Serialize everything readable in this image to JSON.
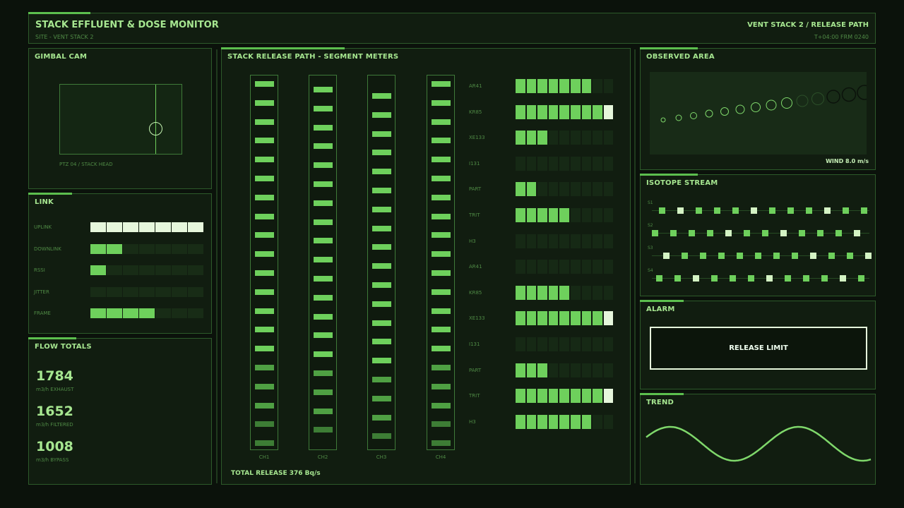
{
  "header": {
    "title": "STACK EFFLUENT & DOSE MONITOR",
    "site": "SITE - VENT STACK 2",
    "right_title": "VENT STACK 2 / RELEASE PATH",
    "time": "T+04:00  FRM 0240"
  },
  "gimbal": {
    "title": "GIMBAL CAM",
    "label": "PTZ 04 / STACK HEAD"
  },
  "link": {
    "title": "LINK",
    "rows": [
      {
        "label": "UPLINK",
        "on": 7,
        "style": "hi"
      },
      {
        "label": "DOWNLINK",
        "on": 2,
        "style": "on"
      },
      {
        "label": "RSSI",
        "on": 1,
        "style": "on"
      },
      {
        "label": "JITTER",
        "on": 0,
        "style": "on"
      },
      {
        "label": "FRAME",
        "on": 4,
        "style": "on"
      }
    ],
    "segments": 7
  },
  "flow": {
    "title": "FLOW TOTALS",
    "items": [
      {
        "value": "1784",
        "unit": "m3/h EXHAUST"
      },
      {
        "value": "1652",
        "unit": "m3/h FILTERED"
      },
      {
        "value": "1008",
        "unit": "m3/h BYPASS"
      }
    ]
  },
  "center": {
    "title": "STACK RELEASE PATH - SEGMENT METERS",
    "columns": [
      "CH1",
      "CH2",
      "CH3",
      "CH4"
    ],
    "total": "TOTAL RELEASE 376 Bq/s",
    "meter_segments": 9,
    "meters": [
      {
        "label": "AR41",
        "on": 7,
        "peak": false
      },
      {
        "label": "KR85",
        "on": 9,
        "peak": true
      },
      {
        "label": "XE133",
        "on": 3,
        "peak": false
      },
      {
        "label": "I131",
        "on": 0,
        "peak": false
      },
      {
        "label": "PART",
        "on": 2,
        "peak": false
      },
      {
        "label": "TRIT",
        "on": 5,
        "peak": false
      },
      {
        "label": "H3",
        "on": 0,
        "peak": false
      },
      {
        "label": "AR41",
        "on": 0,
        "peak": false
      },
      {
        "label": "KR85",
        "on": 5,
        "peak": false
      },
      {
        "label": "XE133",
        "on": 9,
        "peak": true
      },
      {
        "label": "I131",
        "on": 0,
        "peak": false
      },
      {
        "label": "PART",
        "on": 3,
        "peak": false
      },
      {
        "label": "TRIT",
        "on": 9,
        "peak": true
      },
      {
        "label": "H3",
        "on": 7,
        "peak": false
      }
    ]
  },
  "observed": {
    "title": "OBSERVED AREA",
    "wind": "WIND 8.0 m/s"
  },
  "isotope": {
    "title": "ISOTOPE STREAM",
    "streams": [
      "S1",
      "S2",
      "S3",
      "S4"
    ]
  },
  "alarm": {
    "title": "ALARM",
    "message": "RELEASE LIMIT"
  },
  "trend": {
    "title": "TREND"
  },
  "colors": {
    "accent": "#6ed05c",
    "highlight": "#e6f7dc",
    "dim": "#162915"
  }
}
